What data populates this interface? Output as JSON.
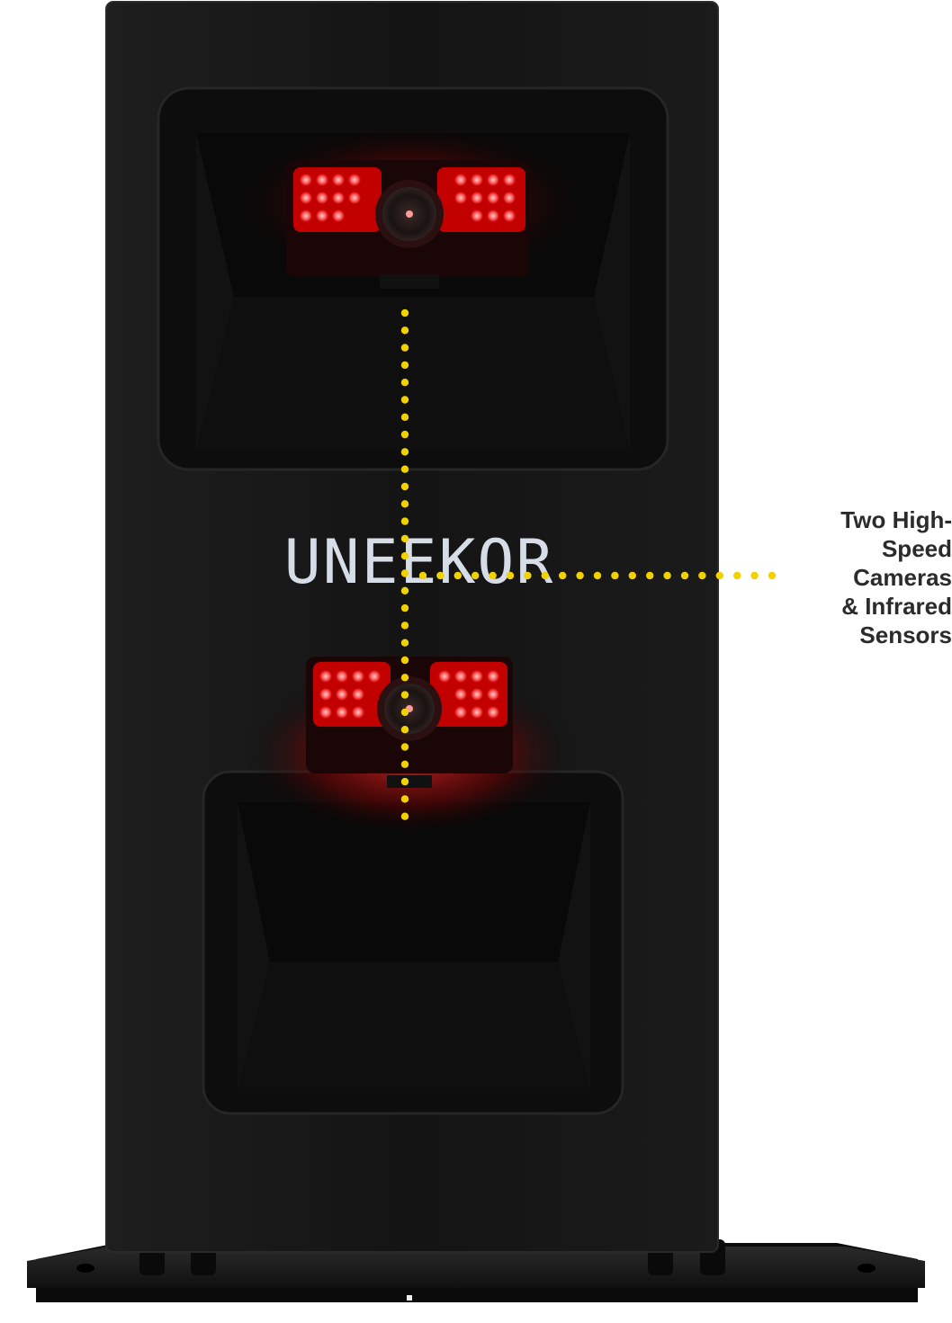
{
  "device": {
    "brand_text": "UNEEKOR",
    "body_color": "#141414",
    "led_color": "#ff2a2a"
  },
  "callout": {
    "lines": [
      "Two High-",
      "Speed",
      "Cameras",
      "& Infrared",
      "Sensors"
    ],
    "dot_color": "#f2d100",
    "text_color": "#2b2b2b"
  }
}
